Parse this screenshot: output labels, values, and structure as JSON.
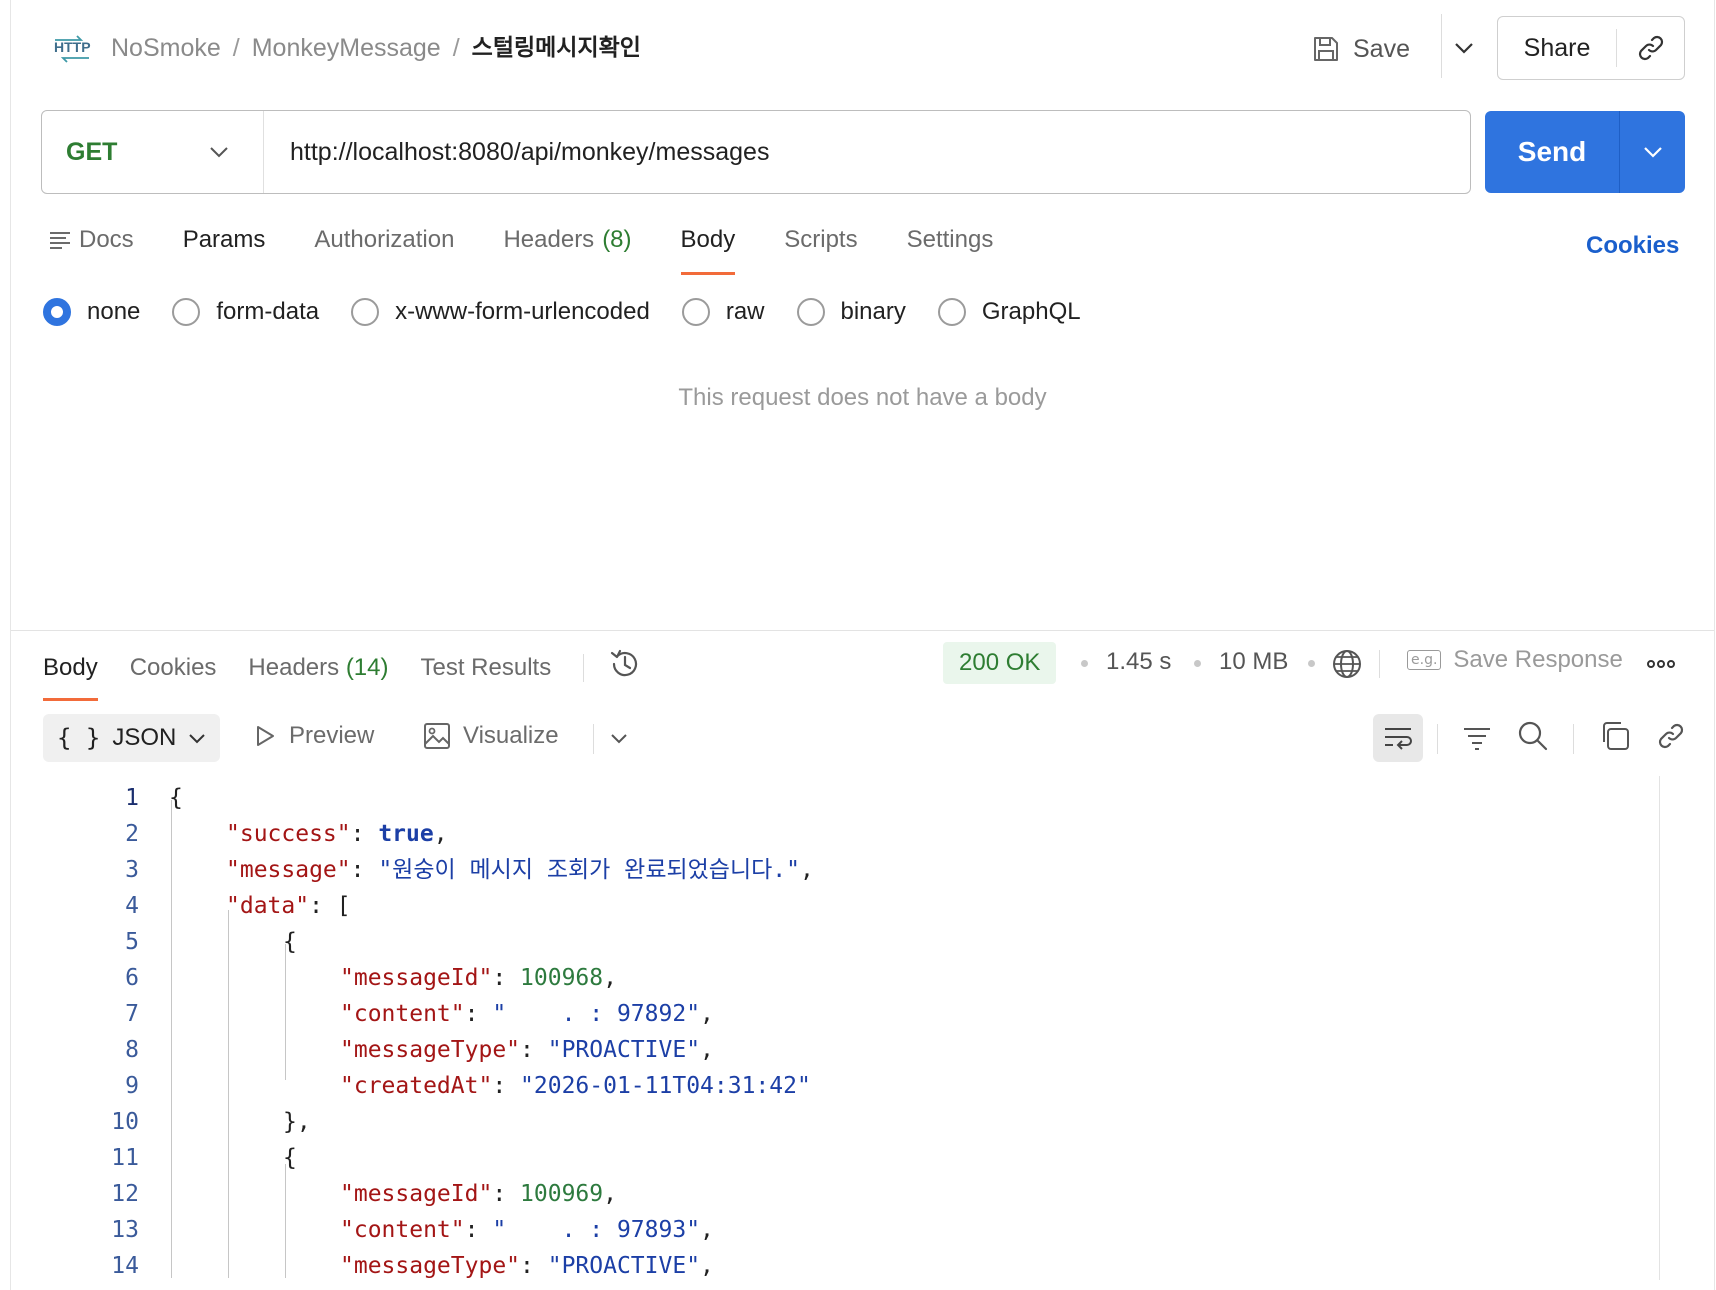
{
  "header": {
    "breadcrumbs": [
      "NoSmoke",
      "MonkeyMessage",
      "스털링메시지확인"
    ],
    "separator": "/",
    "save_label": "Save",
    "share_label": "Share"
  },
  "request": {
    "method": "GET",
    "url": "http://localhost:8080/api/monkey/messages",
    "send_label": "Send",
    "tabs": [
      {
        "label": "Docs"
      },
      {
        "label": "Params"
      },
      {
        "label": "Authorization"
      },
      {
        "label": "Headers",
        "count": "(8)"
      },
      {
        "label": "Body"
      },
      {
        "label": "Scripts"
      },
      {
        "label": "Settings"
      }
    ],
    "active_tab": "Body",
    "cookies_label": "Cookies",
    "body_types": [
      "none",
      "form-data",
      "x-www-form-urlencoded",
      "raw",
      "binary",
      "GraphQL"
    ],
    "selected_body_type": "none",
    "empty_message": "This request does not have a body"
  },
  "response": {
    "tabs": [
      {
        "label": "Body"
      },
      {
        "label": "Cookies"
      },
      {
        "label": "Headers",
        "count": "(14)"
      },
      {
        "label": "Test Results"
      }
    ],
    "status": "200 OK",
    "time": "1.45 s",
    "size": "10 MB",
    "save_response_label": "Save Response",
    "eg_label": "e.g.",
    "format_label": "JSON",
    "format_braces": "{ }",
    "preview_label": "Preview",
    "visualize_label": "Visualize",
    "code_lines": [
      {
        "n": "1",
        "indent": 0,
        "parts": [
          {
            "t": "{",
            "c": "p"
          }
        ]
      },
      {
        "n": "2",
        "indent": 1,
        "parts": [
          {
            "t": "\"success\"",
            "c": "k"
          },
          {
            "t": ": ",
            "c": "p"
          },
          {
            "t": "true",
            "c": "b"
          },
          {
            "t": ",",
            "c": "p"
          }
        ]
      },
      {
        "n": "3",
        "indent": 1,
        "parts": [
          {
            "t": "\"message\"",
            "c": "k"
          },
          {
            "t": ": ",
            "c": "p"
          },
          {
            "t": "\"원숭이 메시지 조회가 완료되었습니다.\"",
            "c": "s"
          },
          {
            "t": ",",
            "c": "p"
          }
        ]
      },
      {
        "n": "4",
        "indent": 1,
        "parts": [
          {
            "t": "\"data\"",
            "c": "k"
          },
          {
            "t": ": [",
            "c": "p"
          }
        ]
      },
      {
        "n": "5",
        "indent": 2,
        "parts": [
          {
            "t": "{",
            "c": "p"
          }
        ]
      },
      {
        "n": "6",
        "indent": 3,
        "parts": [
          {
            "t": "\"messageId\"",
            "c": "k"
          },
          {
            "t": ": ",
            "c": "p"
          },
          {
            "t": "100968",
            "c": "n"
          },
          {
            "t": ",",
            "c": "p"
          }
        ]
      },
      {
        "n": "7",
        "indent": 3,
        "parts": [
          {
            "t": "\"content\"",
            "c": "k"
          },
          {
            "t": ": ",
            "c": "p"
          },
          {
            "t": "\"    . : 97892\"",
            "c": "s"
          },
          {
            "t": ",",
            "c": "p"
          }
        ]
      },
      {
        "n": "8",
        "indent": 3,
        "parts": [
          {
            "t": "\"messageType\"",
            "c": "k"
          },
          {
            "t": ": ",
            "c": "p"
          },
          {
            "t": "\"PROACTIVE\"",
            "c": "s"
          },
          {
            "t": ",",
            "c": "p"
          }
        ]
      },
      {
        "n": "9",
        "indent": 3,
        "parts": [
          {
            "t": "\"createdAt\"",
            "c": "k"
          },
          {
            "t": ": ",
            "c": "p"
          },
          {
            "t": "\"2026-01-11T04:31:42\"",
            "c": "s"
          }
        ]
      },
      {
        "n": "10",
        "indent": 2,
        "parts": [
          {
            "t": "},",
            "c": "p"
          }
        ]
      },
      {
        "n": "11",
        "indent": 2,
        "parts": [
          {
            "t": "{",
            "c": "p"
          }
        ]
      },
      {
        "n": "12",
        "indent": 3,
        "parts": [
          {
            "t": "\"messageId\"",
            "c": "k"
          },
          {
            "t": ": ",
            "c": "p"
          },
          {
            "t": "100969",
            "c": "n"
          },
          {
            "t": ",",
            "c": "p"
          }
        ]
      },
      {
        "n": "13",
        "indent": 3,
        "parts": [
          {
            "t": "\"content\"",
            "c": "k"
          },
          {
            "t": ": ",
            "c": "p"
          },
          {
            "t": "\"    . : 97893\"",
            "c": "s"
          },
          {
            "t": ",",
            "c": "p"
          }
        ]
      },
      {
        "n": "14",
        "indent": 3,
        "parts": [
          {
            "t": "\"messageType\"",
            "c": "k"
          },
          {
            "t": ": ",
            "c": "p"
          },
          {
            "t": "\"PROACTIVE\"",
            "c": "s"
          },
          {
            "t": ",",
            "c": "p"
          }
        ]
      }
    ]
  },
  "colors": {
    "accent": "#2f74df",
    "tab_underline": "#f26b3a",
    "success": "#2e7d32",
    "link": "#1a5fcc"
  },
  "icons": [
    "http-icon",
    "save-icon",
    "chevron-down-icon",
    "link-icon",
    "docs-icon",
    "history-icon",
    "globe-icon",
    "more-icon",
    "play-icon",
    "image-icon",
    "wrap-icon",
    "filter-icon",
    "search-icon",
    "copy-icon"
  ]
}
